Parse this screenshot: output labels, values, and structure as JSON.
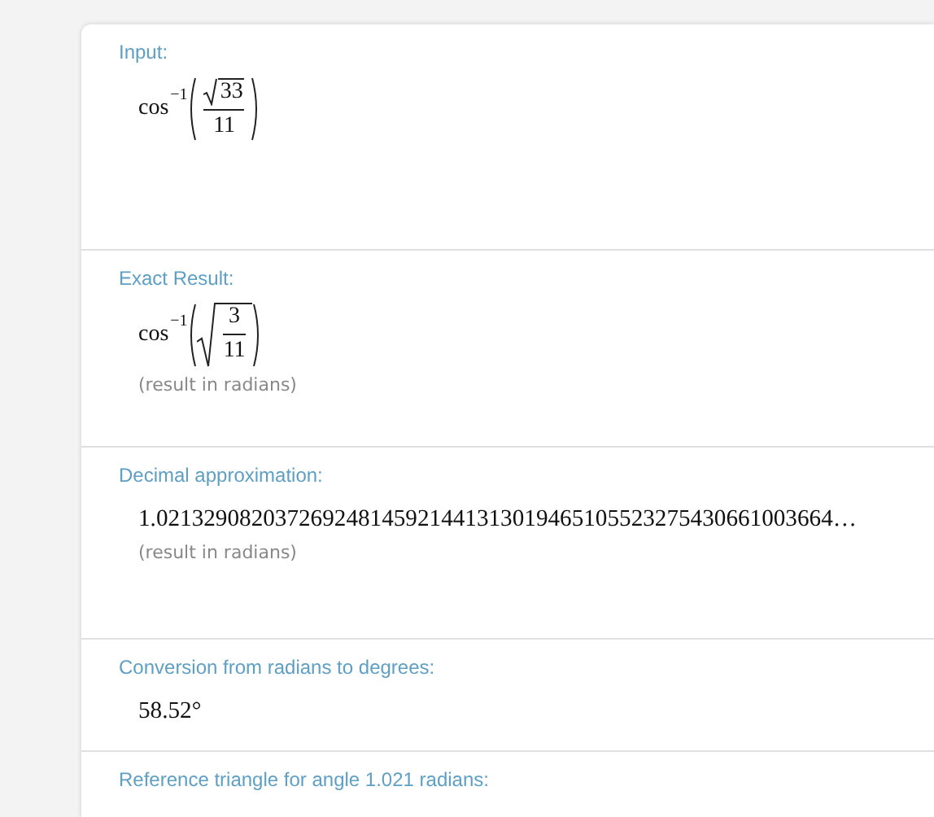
{
  "pods": [
    {
      "title": "Input:",
      "kind": "formula",
      "formula": {
        "kind": "sqrt-numerator",
        "func": "cos",
        "exponent": "−1",
        "numerator": "33",
        "denominator": "11"
      }
    },
    {
      "title": "Exact Result:",
      "kind": "formula",
      "formula": {
        "kind": "sqrt-whole",
        "func": "cos",
        "exponent": "−1",
        "numerator": "3",
        "denominator": "11"
      },
      "note": "(result in radians)"
    },
    {
      "title": "Decimal approximation:",
      "kind": "text",
      "value": "1.021329082037269248145921441313019465105523275430661003664…",
      "note": "(result in radians)"
    },
    {
      "title": "Conversion from radians to degrees:",
      "kind": "text",
      "value": "58.52°"
    },
    {
      "title": "Reference triangle for angle 1.021 radians:",
      "kind": "empty"
    }
  ]
}
